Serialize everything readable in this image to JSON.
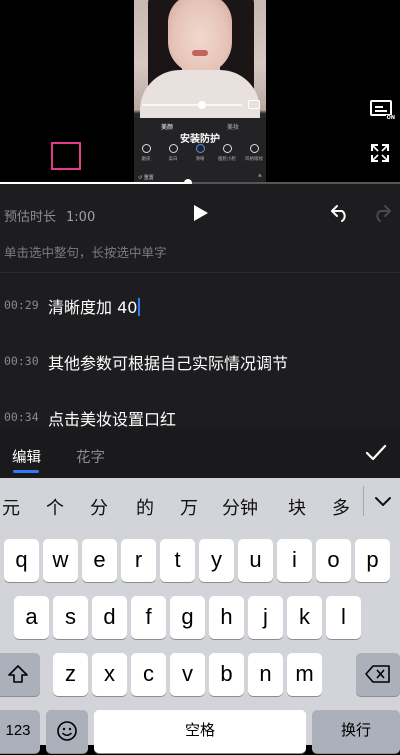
{
  "video": {
    "overlay_text": "安装防护",
    "panel_tabs": [
      "美颜",
      "美妆"
    ],
    "panel_items": [
      "磨皮",
      "美白",
      "清晰",
      "瘦脸小脸",
      "风格眼妆"
    ],
    "panel_bottom_left": "↺ 重置",
    "panel_bottom_right": "≚"
  },
  "toolbar": {
    "duration_label": "预估时长",
    "duration_value": "1:00"
  },
  "hint": "单击选中整句，长按选中单字",
  "subtitles": [
    {
      "time": "00:29",
      "text": "清晰度加 40"
    },
    {
      "time": "00:30",
      "text": "其他参数可根据自己实际情况调节"
    },
    {
      "time": "00:34",
      "text": "点击美妆设置口红"
    }
  ],
  "progress": 0.47,
  "tabs": {
    "edit": "编辑",
    "flower_text": "花字"
  },
  "candidates": [
    "元",
    "个",
    "分",
    "的",
    "万",
    "分钟",
    "块",
    "多"
  ],
  "keyboard": {
    "row1": [
      "q",
      "w",
      "e",
      "r",
      "t",
      "y",
      "u",
      "i",
      "o",
      "p"
    ],
    "row2": [
      "a",
      "s",
      "d",
      "f",
      "g",
      "h",
      "j",
      "k",
      "l"
    ],
    "row3": [
      "z",
      "x",
      "c",
      "v",
      "b",
      "n",
      "m"
    ],
    "numbers_key": "123",
    "space_key": "空格",
    "return_key": "换行"
  },
  "colors": {
    "accent": "#2f7cf6",
    "highlight_box": "#e23b87"
  }
}
